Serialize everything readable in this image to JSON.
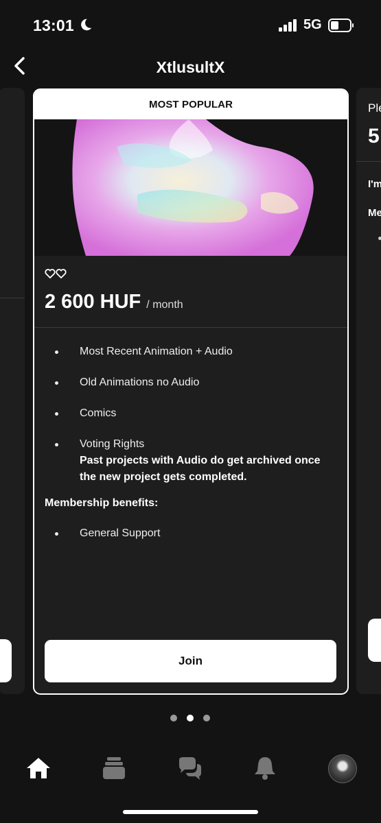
{
  "status_bar": {
    "time": "13:01",
    "network": "5G"
  },
  "header": {
    "title": "XtlusultX"
  },
  "main_card": {
    "banner": "MOST POPULAR",
    "price": "2 600 HUF",
    "period": "/ month",
    "benefits": [
      "Most Recent Animation + Audio",
      "Old Animations no Audio",
      "Comics",
      "Voting Rights"
    ],
    "note": "Past projects with Audio do get archived once the new project gets completed.",
    "membership_heading": "Membership benefits:",
    "membership_items": [
      "General Support"
    ],
    "join_label": "Join"
  },
  "right_card": {
    "t1": "Ple",
    "t2": "5",
    "t3": "I'm",
    "t4": "Me"
  },
  "pager": {
    "count": 3,
    "active_index": 1
  },
  "tabbar": {
    "items": [
      "home-icon",
      "library-icon",
      "chat-icon",
      "bell-icon",
      "avatar"
    ]
  },
  "colors": {
    "background": "#131313",
    "card": "#1e1e1e",
    "accent": "#ffffff"
  }
}
